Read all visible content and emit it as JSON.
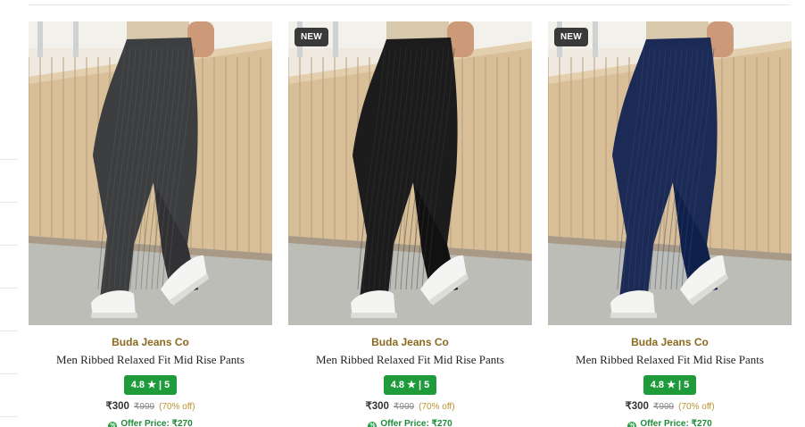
{
  "products": [
    {
      "brand": "Buda Jeans Co",
      "title": "Men Ribbed Relaxed Fit Mid Rise Pants",
      "badge": "",
      "rating": "4.8",
      "rating_count": "5",
      "price": "₹300",
      "mrp": "₹999",
      "discount": "(70% off)",
      "offer_label": "Offer Price: ₹270",
      "pant_color": "#3d3e40"
    },
    {
      "brand": "Buda Jeans Co",
      "title": "Men Ribbed Relaxed Fit Mid Rise Pants",
      "badge": "NEW",
      "rating": "4.8",
      "rating_count": "5",
      "price": "₹300",
      "mrp": "₹999",
      "discount": "(70% off)",
      "offer_label": "Offer Price: ₹270",
      "pant_color": "#1c1c1d"
    },
    {
      "brand": "Buda Jeans Co",
      "title": "Men Ribbed Relaxed Fit Mid Rise Pants",
      "badge": "NEW",
      "rating": "4.8",
      "rating_count": "5",
      "price": "₹300",
      "mrp": "₹999",
      "discount": "(70% off)",
      "offer_label": "Offer Price: ₹270",
      "pant_color": "#1b2b55"
    }
  ],
  "colors": {
    "brand_text": "#8a6a1f",
    "rating_bg": "#1f9b3c",
    "badge_bg": "#3a3a3a"
  },
  "icons": {
    "star": "star-icon",
    "offer": "offer-tag-icon"
  }
}
